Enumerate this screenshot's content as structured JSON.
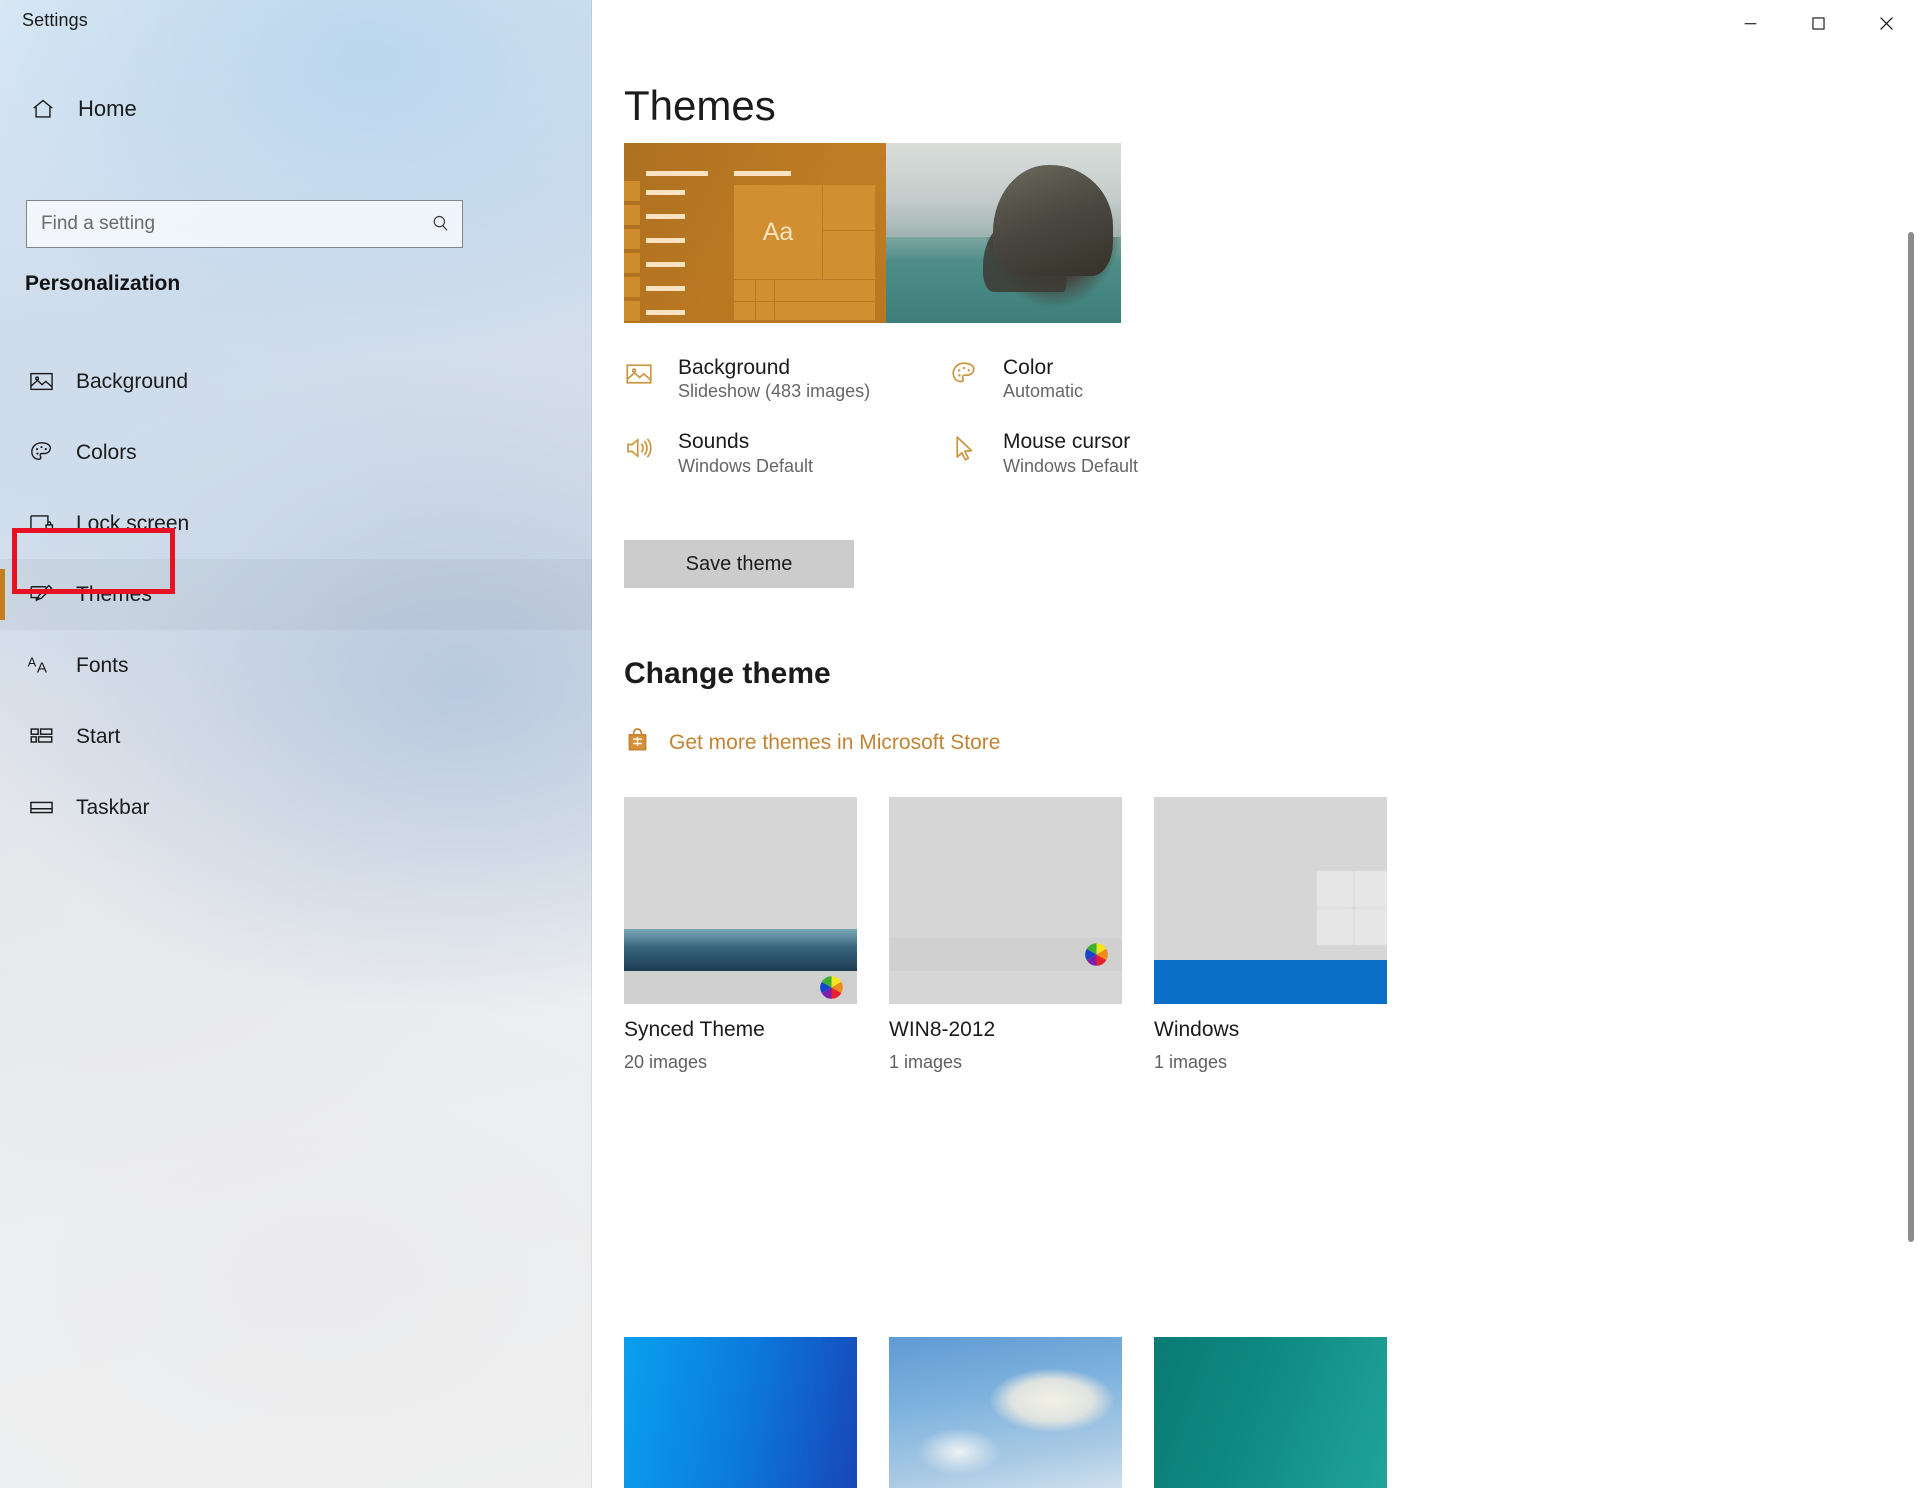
{
  "window": {
    "title": "Settings",
    "controls": [
      {
        "name": "minimize",
        "glyph": "–"
      },
      {
        "name": "maximize",
        "glyph": "□"
      },
      {
        "name": "close",
        "glyph": "✕"
      }
    ]
  },
  "sidebar": {
    "home_label": "Home",
    "home_icon": "home-icon",
    "search": {
      "placeholder": "Find a setting",
      "value": "",
      "icon": "search-icon"
    },
    "group_title": "Personalization",
    "accent_color": "#c47e1d",
    "highlight_color": "#e81123",
    "items": [
      {
        "label": "Background",
        "icon": "picture-icon",
        "selected": false
      },
      {
        "label": "Colors",
        "icon": "palette-icon",
        "selected": false
      },
      {
        "label": "Lock screen",
        "icon": "lock-screen-icon",
        "selected": false
      },
      {
        "label": "Themes",
        "icon": "themes-brush-icon",
        "selected": true
      },
      {
        "label": "Fonts",
        "icon": "fonts-aa-icon",
        "selected": false
      },
      {
        "label": "Start",
        "icon": "start-tiles-icon",
        "selected": false
      },
      {
        "label": "Taskbar",
        "icon": "taskbar-icon",
        "selected": false
      }
    ]
  },
  "main": {
    "page_title": "Themes",
    "preview_alt": "Aa",
    "details": [
      {
        "name": "Background",
        "value": "Slideshow (483 images)",
        "icon": "picture-icon"
      },
      {
        "name": "Color",
        "value": "Automatic",
        "icon": "palette-icon"
      },
      {
        "name": "Sounds",
        "value": "Windows Default",
        "icon": "speaker-icon"
      },
      {
        "name": "Mouse cursor",
        "value": "Windows Default",
        "icon": "cursor-arrow-icon"
      }
    ],
    "save_button": "Save theme",
    "change_theme_heading": "Change theme",
    "store_link": {
      "label": "Get more themes in Microsoft Store",
      "icon": "store-bag-icon",
      "color": "#c28435"
    },
    "themes": [
      {
        "name": "Synced Theme",
        "images": "20 images",
        "thumb": "volcano",
        "has_color_wheel": true
      },
      {
        "name": "WIN8-2012",
        "images": "1 images",
        "thumb": "white",
        "has_color_wheel": true
      },
      {
        "name": "Windows",
        "images": "1 images",
        "thumb": "windows",
        "has_color_wheel": false
      }
    ],
    "partial_themes": [
      {
        "thumb": "blue-gradient"
      },
      {
        "thumb": "sky-clouds"
      },
      {
        "thumb": "teal"
      }
    ]
  },
  "scrollbar": {
    "name": "vertical-scrollbar"
  }
}
